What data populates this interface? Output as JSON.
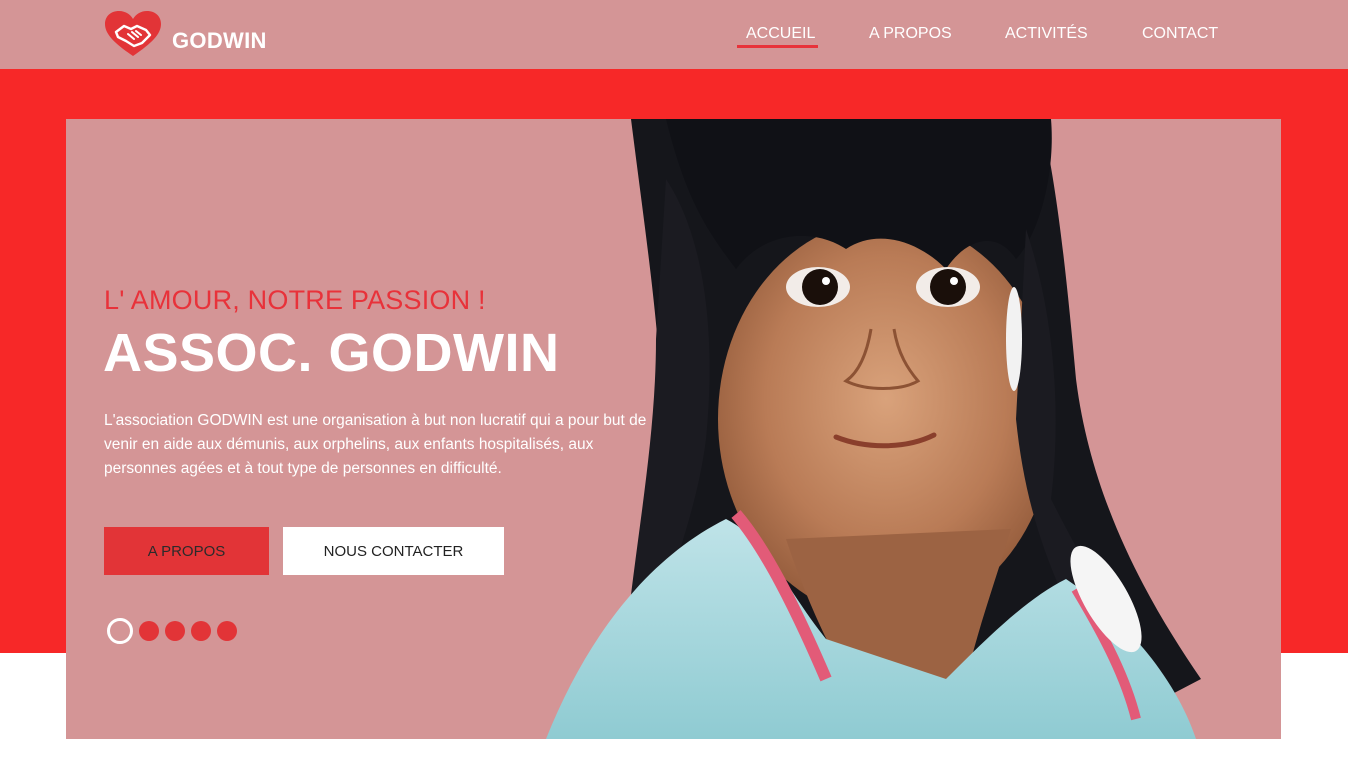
{
  "header": {
    "brand": "GODWIN",
    "logo_icon": "heart-handshake-icon",
    "nav": [
      {
        "label": "ACCUEIL",
        "active": true
      },
      {
        "label": "A PROPOS",
        "active": false
      },
      {
        "label": "ACTIVITÉS",
        "active": false
      },
      {
        "label": "CONTACT",
        "active": false
      }
    ]
  },
  "hero": {
    "tagline": "L' AMOUR, NOTRE PASSION !",
    "title": "ASSOC. GODWIN",
    "description": "L'association GODWIN est une organisation à but non lucratif qui a pour but de venir en aide aux démunis, aux orphelins, aux enfants hospitalisés, aux personnes agées et à tout type de personnes en difficulté.",
    "primary_button": "A PROPOS",
    "secondary_button": "NOUS CONTACTER",
    "slides": {
      "count": 5,
      "active_index": 0
    },
    "image": "portrait-of-young-girl"
  },
  "colors": {
    "header_bg": "#d49596",
    "accent_red": "#f72828",
    "button_red": "#e23437",
    "hero_bg": "#d49596",
    "text_light": "#ffffff"
  }
}
